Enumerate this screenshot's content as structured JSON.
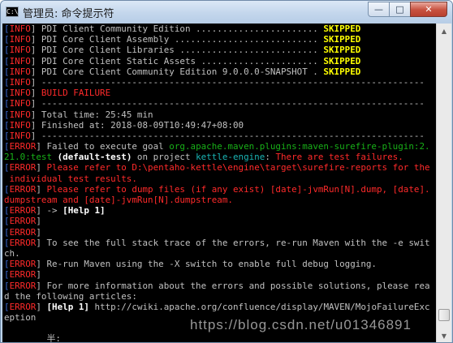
{
  "window": {
    "title": "管理员: 命令提示符",
    "icon_name": "cmd-icon",
    "icon_text": "C:\\",
    "minimize_glyph": "—",
    "maximize_glyph": "□",
    "close_glyph": "✕"
  },
  "console": {
    "lines": [
      [
        [
          "[",
          "blue"
        ],
        [
          "INFO",
          "red"
        ],
        [
          "] PDI Client Community Edition ....................... ",
          ""
        ],
        [
          "SKIPPED",
          "yellow"
        ]
      ],
      [
        [
          "[",
          "blue"
        ],
        [
          "INFO",
          "red"
        ],
        [
          "] PDI Core Client Assembly ........................... ",
          ""
        ],
        [
          "SKIPPED",
          "yellow"
        ]
      ],
      [
        [
          "[",
          "blue"
        ],
        [
          "INFO",
          "red"
        ],
        [
          "] PDI Core Client Libraries .......................... ",
          ""
        ],
        [
          "SKIPPED",
          "yellow"
        ]
      ],
      [
        [
          "[",
          "blue"
        ],
        [
          "INFO",
          "red"
        ],
        [
          "] PDI Core Client Static Assets ...................... ",
          ""
        ],
        [
          "SKIPPED",
          "yellow"
        ]
      ],
      [
        [
          "[",
          "blue"
        ],
        [
          "INFO",
          "red"
        ],
        [
          "] PDI Core Client Community Edition 9.0.0.0-SNAPSHOT . ",
          ""
        ],
        [
          "SKIPPED",
          "yellow"
        ]
      ],
      [
        [
          "[",
          "blue"
        ],
        [
          "INFO",
          "red"
        ],
        [
          "] ------------------------------------------------------------------------",
          ""
        ]
      ],
      [
        [
          "[",
          "blue"
        ],
        [
          "INFO",
          "red"
        ],
        [
          "] ",
          ""
        ],
        [
          "BUILD FAILURE",
          "red"
        ]
      ],
      [
        [
          "[",
          "blue"
        ],
        [
          "INFO",
          "red"
        ],
        [
          "] ------------------------------------------------------------------------",
          ""
        ]
      ],
      [
        [
          "[",
          "blue"
        ],
        [
          "INFO",
          "red"
        ],
        [
          "] Total time: 25:45 min",
          ""
        ]
      ],
      [
        [
          "[",
          "blue"
        ],
        [
          "INFO",
          "red"
        ],
        [
          "] Finished at: 2018-08-09T10:49:47+08:00",
          ""
        ]
      ],
      [
        [
          "[",
          "blue"
        ],
        [
          "INFO",
          "red"
        ],
        [
          "] ------------------------------------------------------------------------",
          ""
        ]
      ],
      [
        [
          "[",
          "blue"
        ],
        [
          "ERROR",
          "red"
        ],
        [
          "] Failed to execute goal ",
          ""
        ],
        [
          "org.apache.maven.plugins:maven-surefire-plugin:2.",
          "green"
        ]
      ],
      [
        [
          "21.0:test",
          "green"
        ],
        [
          " ",
          ""
        ],
        [
          "(default-test)",
          "white"
        ],
        [
          " on project ",
          ""
        ],
        [
          "kettle-engine",
          "cyan"
        ],
        [
          ": ",
          ""
        ],
        [
          "There are test failures.",
          "red"
        ]
      ],
      [
        [
          "[",
          "blue"
        ],
        [
          "ERROR",
          "red"
        ],
        [
          "] ",
          ""
        ],
        [
          "Please refer to D:\\pentaho-kettle\\engine\\target\\surefire-reports for the",
          "red"
        ]
      ],
      [
        [
          " individual test results.",
          "red"
        ]
      ],
      [
        [
          "[",
          "blue"
        ],
        [
          "ERROR",
          "red"
        ],
        [
          "] ",
          ""
        ],
        [
          "Please refer to dump files (if any exist) [date]-jvmRun[N].dump, [date].",
          "red"
        ]
      ],
      [
        [
          "dumpstream and [date]-jvmRun[N].dumpstream.",
          "red"
        ]
      ],
      [
        [
          "[",
          "blue"
        ],
        [
          "ERROR",
          "red"
        ],
        [
          "] -> ",
          ""
        ],
        [
          "[Help 1]",
          "white"
        ]
      ],
      [
        [
          "[",
          "blue"
        ],
        [
          "ERROR",
          "red"
        ],
        [
          "]",
          ""
        ]
      ],
      [
        [
          "[",
          "blue"
        ],
        [
          "ERROR",
          "red"
        ],
        [
          "]",
          ""
        ]
      ],
      [
        [
          "[",
          "blue"
        ],
        [
          "ERROR",
          "red"
        ],
        [
          "] To see the full stack trace of the errors, re-run Maven with the -e swit",
          ""
        ]
      ],
      [
        [
          "ch.",
          ""
        ]
      ],
      [
        [
          "[",
          "blue"
        ],
        [
          "ERROR",
          "red"
        ],
        [
          "] Re-run Maven using the -X switch to enable full debug logging.",
          ""
        ]
      ],
      [
        [
          "[",
          "blue"
        ],
        [
          "ERROR",
          "red"
        ],
        [
          "]",
          ""
        ]
      ],
      [
        [
          "[",
          "blue"
        ],
        [
          "ERROR",
          "red"
        ],
        [
          "] For more information about the errors and possible solutions, please rea",
          ""
        ]
      ],
      [
        [
          "d the following articles:",
          ""
        ]
      ],
      [
        [
          "[",
          "blue"
        ],
        [
          "ERROR",
          "red"
        ],
        [
          "] ",
          ""
        ],
        [
          "[Help 1]",
          "white"
        ],
        [
          " http://cwiki.apache.org/confluence/display/MAVEN/MojoFailureExc",
          ""
        ]
      ],
      [
        [
          "eption",
          ""
        ]
      ],
      [
        [
          "",
          ""
        ]
      ],
      [
        [
          "        半:",
          ""
        ]
      ]
    ]
  },
  "scrollbar": {
    "up_glyph": "▲",
    "down_glyph": "▼",
    "position_fraction": 0.97
  },
  "watermark": {
    "text": "https://blog.csdn.net/u01346891"
  }
}
